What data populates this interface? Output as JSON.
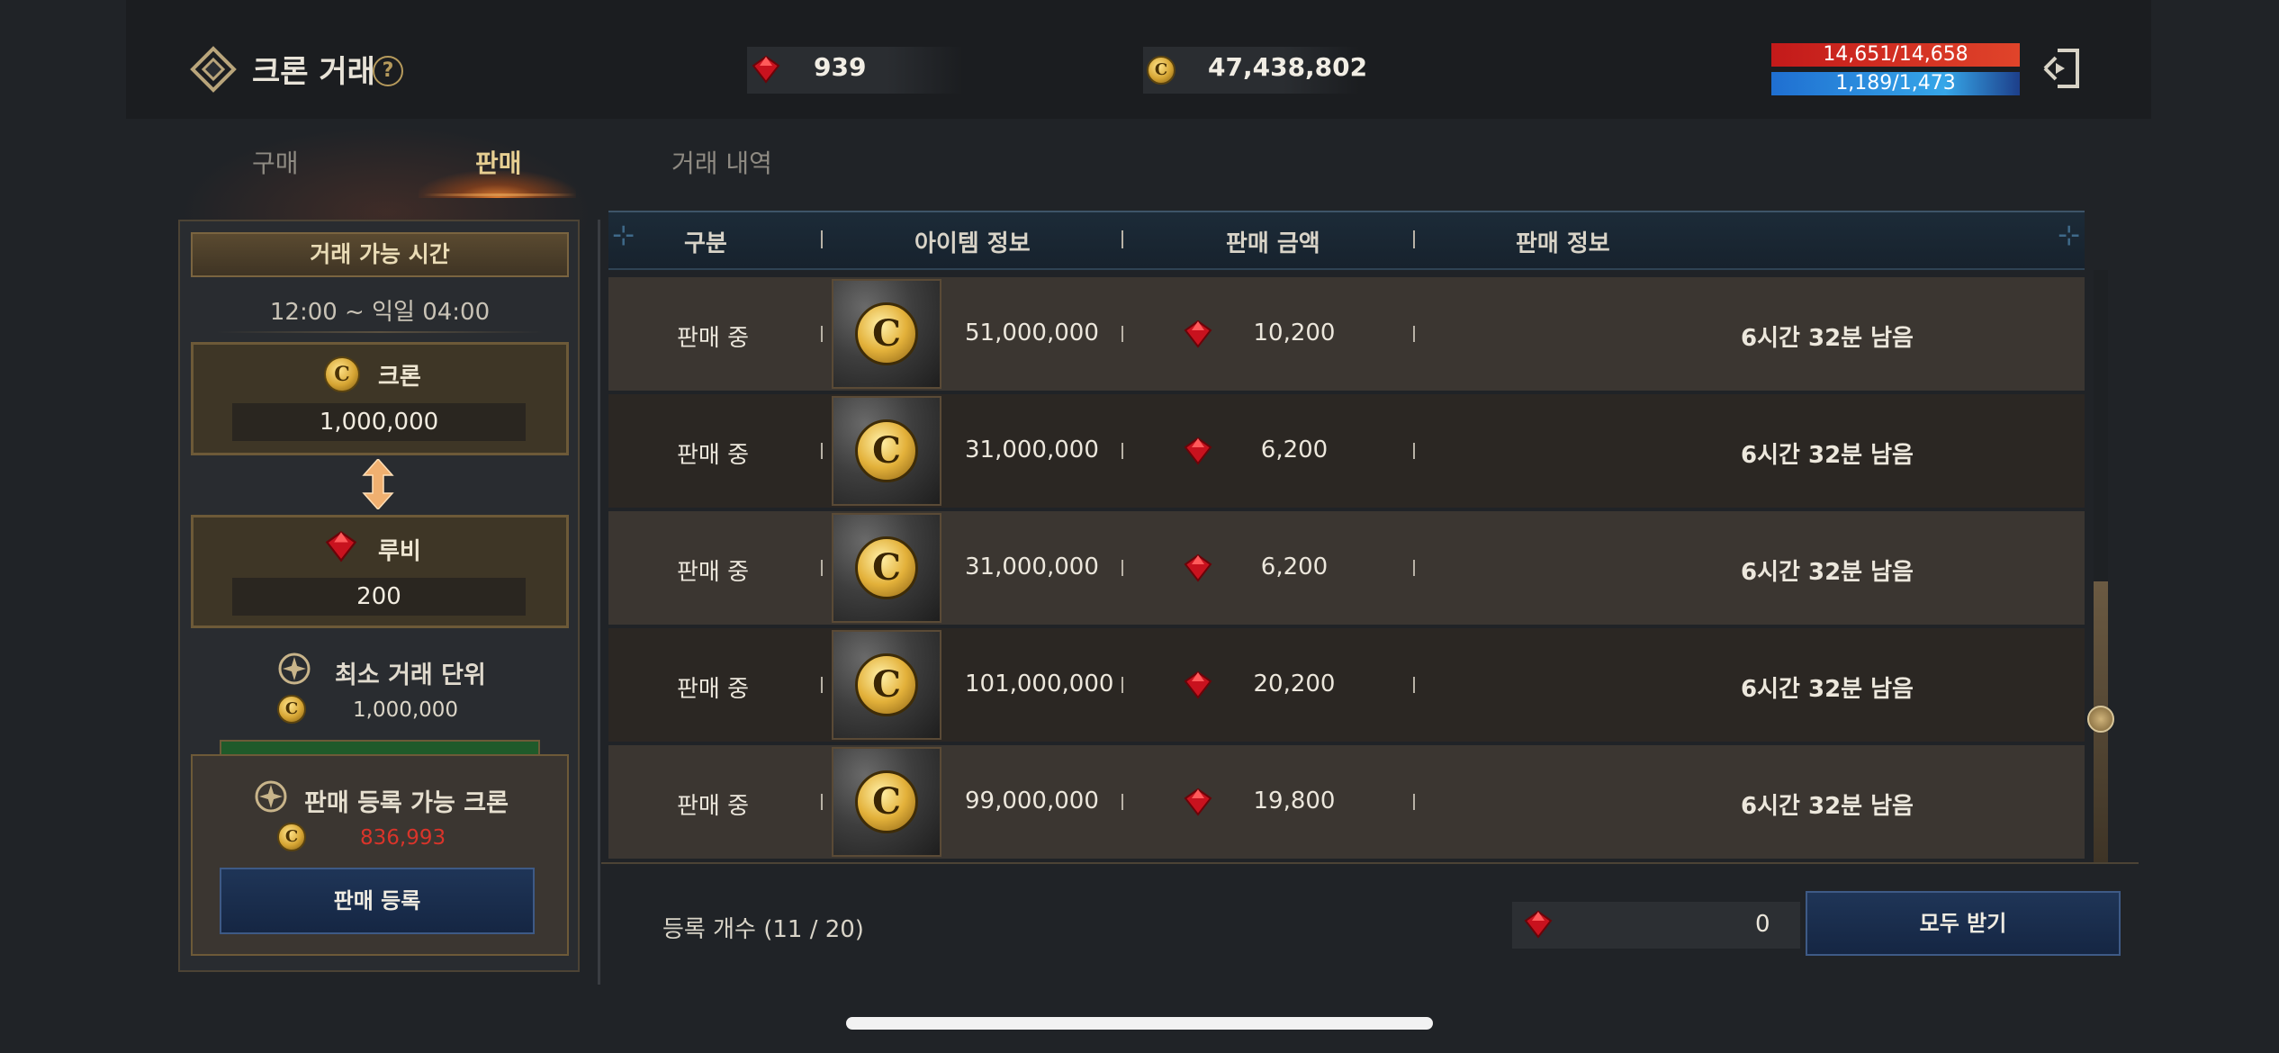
{
  "header": {
    "title": "크론 거래",
    "help": "?",
    "ruby_amount": "939",
    "kron_amount": "47,438,802",
    "hp": "14,651/14,658",
    "mp": "1,189/1,473"
  },
  "tabs": [
    {
      "label": "구매",
      "active": false
    },
    {
      "label": "판매",
      "active": true
    },
    {
      "label": "거래 내역",
      "active": false
    }
  ],
  "left_panel": {
    "trade_time_title": "거래 가능 시간",
    "trade_time_value": "12:00 ~ 익일 04:00",
    "kron_label": "크론",
    "kron_value": "1,000,000",
    "ruby_label": "루비",
    "ruby_value": "200",
    "min_unit_label": "최소 거래 단위",
    "min_unit_value": "1,000,000",
    "sell_available_label": "판매 등록 가능 크론",
    "sell_available_value": "836,993",
    "sell_button": "판매 등록"
  },
  "table": {
    "headers": [
      "구분",
      "아이템 정보",
      "판매 금액",
      "판매 정보"
    ],
    "rows": [
      {
        "status": "판매 중",
        "amount": "51,000,000",
        "price": "10,200",
        "remaining": "6시간 32분 남음"
      },
      {
        "status": "판매 중",
        "amount": "31,000,000",
        "price": "6,200",
        "remaining": "6시간 32분 남음"
      },
      {
        "status": "판매 중",
        "amount": "31,000,000",
        "price": "6,200",
        "remaining": "6시간 32분 남음"
      },
      {
        "status": "판매 중",
        "amount": "101,000,000",
        "price": "20,200",
        "remaining": "6시간 32분 남음"
      },
      {
        "status": "판매 중",
        "amount": "99,000,000",
        "price": "19,800",
        "remaining": "6시간 32분 남음"
      }
    ]
  },
  "footer": {
    "registered_count": "등록 개수 (11 / 20)",
    "claim_amount": "0",
    "claim_all_button": "모두 받기"
  },
  "icons": {
    "coin_letter": "C"
  },
  "colors": {
    "accent_gold": "#e7cf92",
    "warning_red": "#d9342a",
    "button_blue": "#1f3557"
  }
}
